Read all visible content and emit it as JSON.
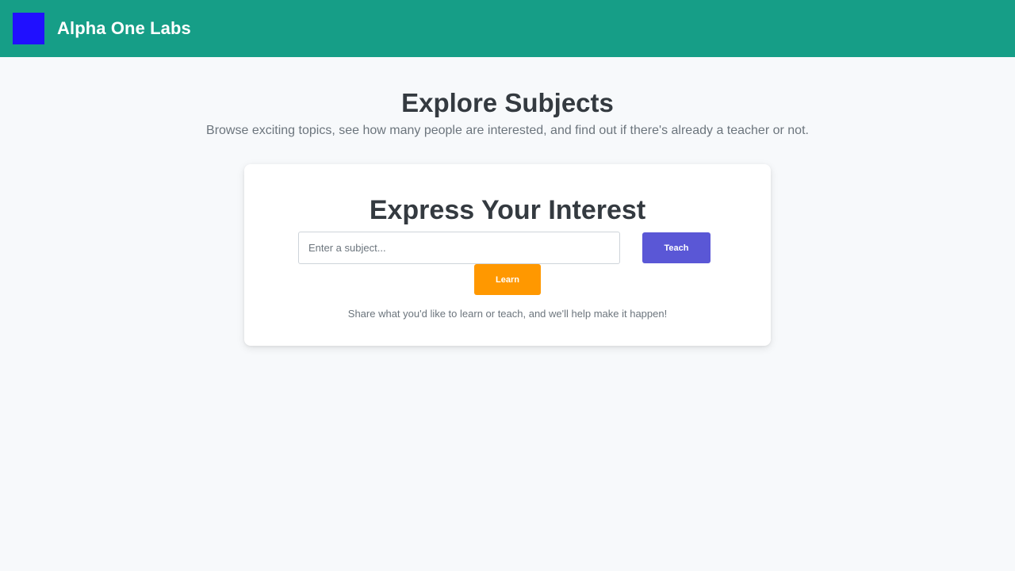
{
  "header": {
    "brand": "Alpha One Labs",
    "logo_color": "#2010ff",
    "bar_color": "#169e87"
  },
  "hero": {
    "title": "Explore Subjects",
    "subtitle": "Browse exciting topics, see how many people are interested, and find out if there's already a teacher or not."
  },
  "interest_card": {
    "title": "Express Your Interest",
    "input": {
      "placeholder": "Enter a subject...",
      "value": ""
    },
    "teach_label": "Teach",
    "learn_label": "Learn",
    "note": "Share what you'd like to learn or teach, and we'll help make it happen!",
    "colors": {
      "teach": "#5a57d6",
      "learn": "#ff9800"
    }
  }
}
